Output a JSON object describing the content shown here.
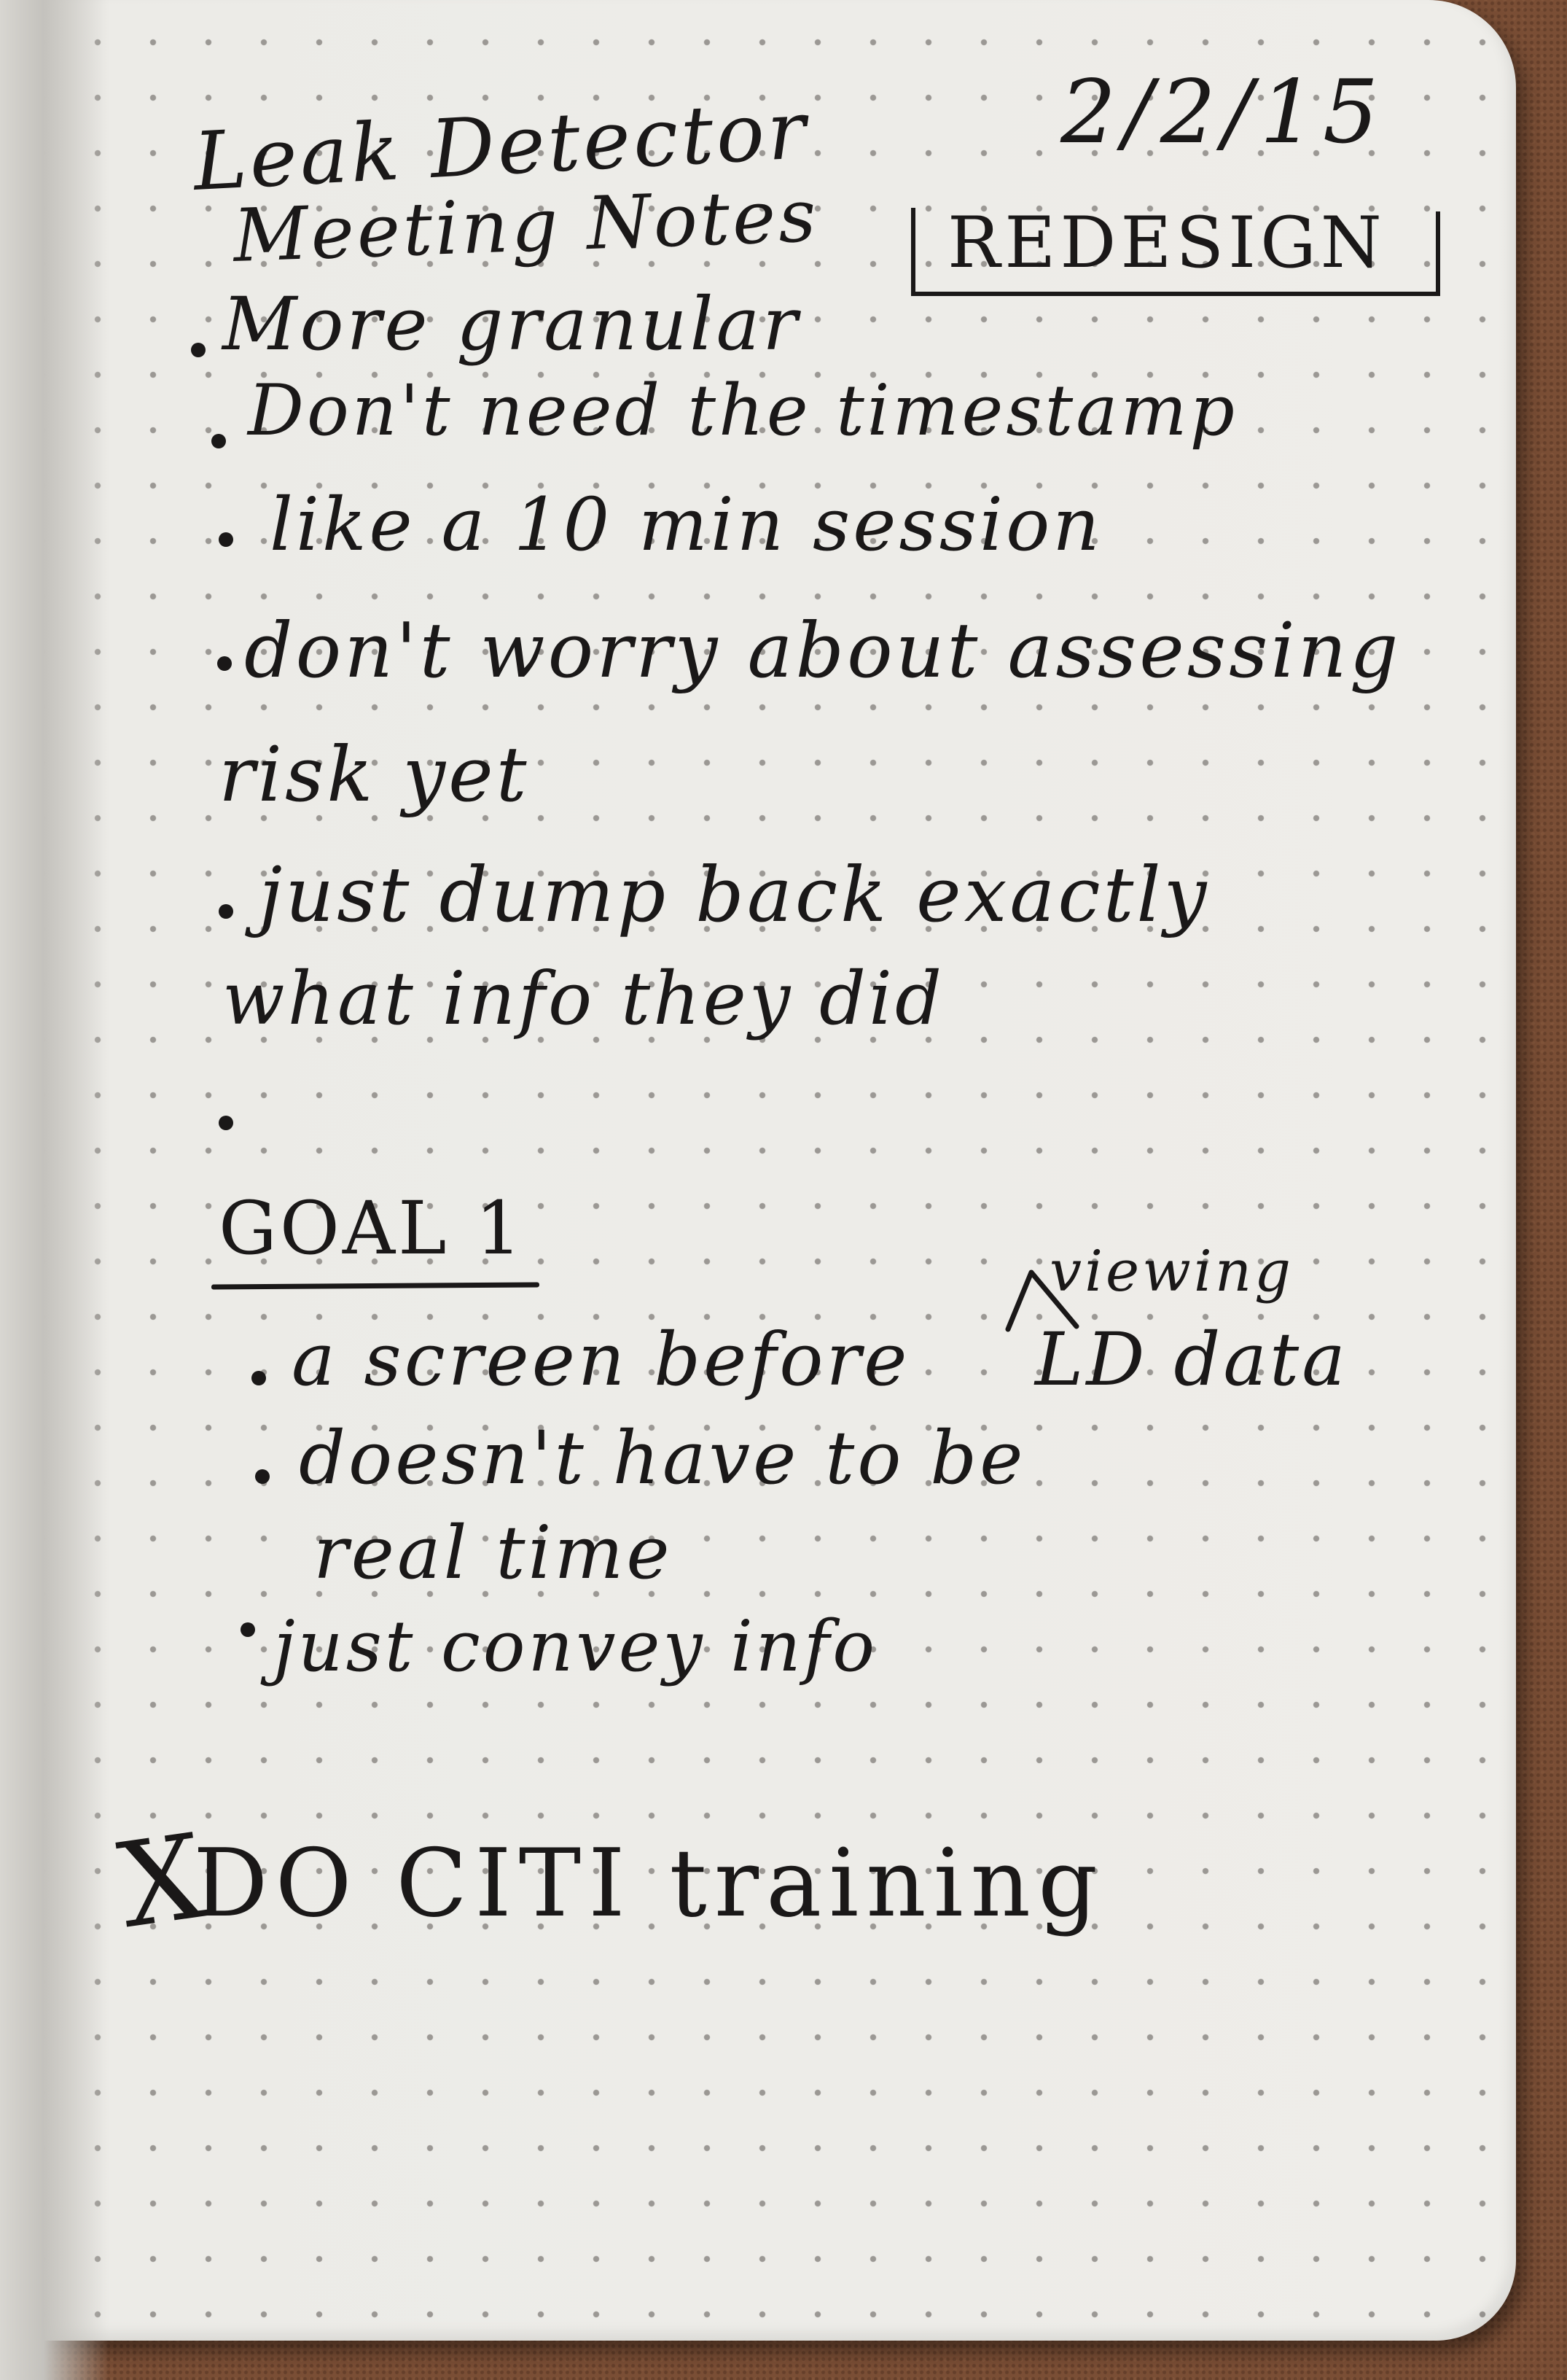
{
  "note": {
    "title_line1": "Leak Detector",
    "title_line2": "Meeting Notes",
    "date": "2/2/15",
    "tag": "REDESIGN",
    "bullets": [
      "More granular",
      "Don't need the timestamp",
      "like a 10 min session",
      "don't worry about assessing",
      "risk yet",
      "just dump back exactly",
      "what info they did"
    ],
    "goal": {
      "heading": "GOAL 1",
      "insert": "viewing",
      "items": [
        "a screen before",
        "LD data",
        "doesn't have to be",
        "real time",
        "just convey info"
      ]
    },
    "todo_mark": "X",
    "todo": "DO  CITI training"
  }
}
